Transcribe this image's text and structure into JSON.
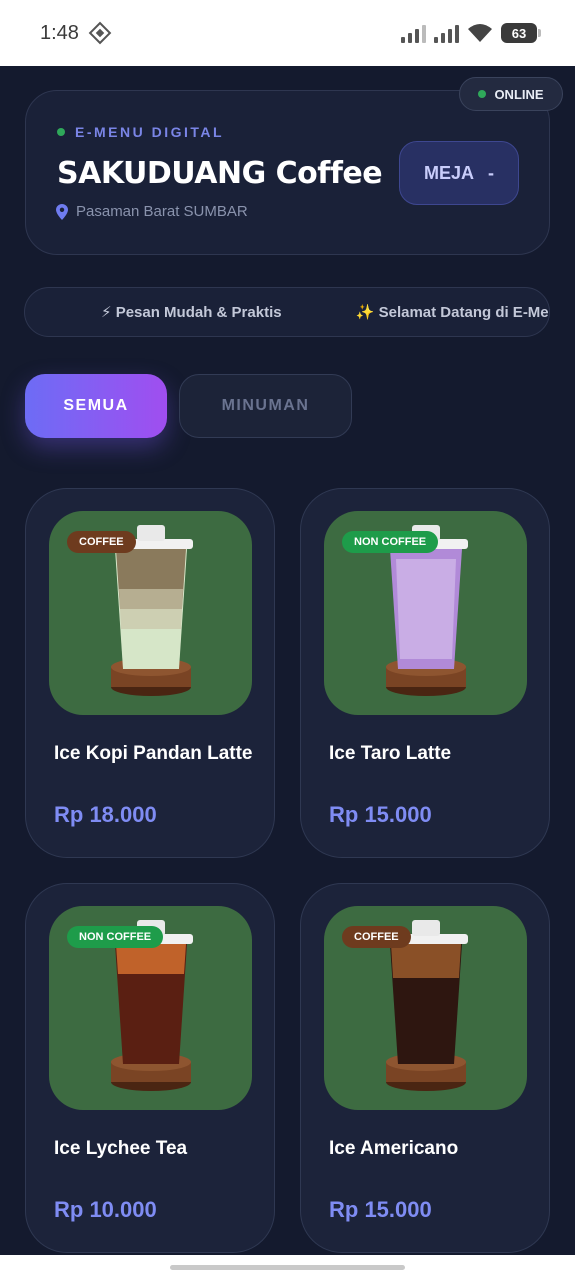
{
  "status_bar": {
    "time": "1:48",
    "battery": "63"
  },
  "header": {
    "online_label": "ONLINE",
    "subtitle": "E-MENU DIGITAL",
    "store_name": "SAKUDUANG Coffee",
    "location": "Pasaman Barat SUMBAR",
    "table_label": "MEJA",
    "table_value": "-"
  },
  "marquee": {
    "items": [
      "⚡ Pesan Mudah & Praktis",
      "✨ Selamat Datang di E-Menu"
    ]
  },
  "tabs": [
    {
      "label": "SEMUA",
      "active": true
    },
    {
      "label": "MINUMAN",
      "active": false
    }
  ],
  "products": [
    {
      "badge": "COFFEE",
      "name": "Ice Kopi Pandan Latte",
      "price": "Rp 18.000"
    },
    {
      "badge": "NON COFFEE",
      "name": "Ice Taro Latte",
      "price": "Rp 15.000"
    },
    {
      "badge": "NON COFFEE",
      "name": "Ice Lychee Tea",
      "price": "Rp 10.000"
    },
    {
      "badge": "COFFEE",
      "name": "Ice Americano",
      "price": "Rp 15.000"
    }
  ],
  "colors": {
    "background": "#141a2e",
    "card": "#1c233a",
    "accent": "#7f8cf3",
    "product_bg": "#3d6b41",
    "badge_coffee": "#6e3b1e",
    "badge_noncoffee": "#1e9c4a"
  },
  "icons": {
    "location": "location-pin-icon",
    "status_online": "green-dot-icon"
  }
}
